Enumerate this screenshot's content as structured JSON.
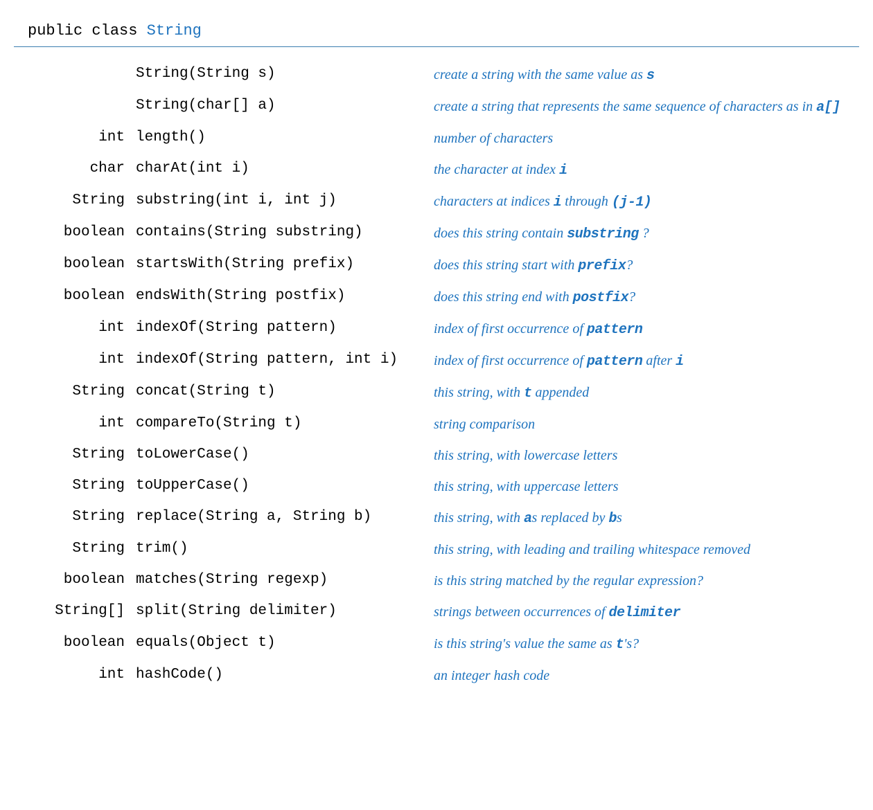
{
  "header": {
    "keyword": "public class",
    "classname": "String"
  },
  "methods": [
    {
      "return_type": "",
      "signature": "String(String s)",
      "description_parts": [
        {
          "t": "text",
          "v": "create a string with the same value as "
        },
        {
          "t": "code",
          "v": "s"
        }
      ]
    },
    {
      "return_type": "",
      "signature": "String(char[] a)",
      "description_parts": [
        {
          "t": "text",
          "v": "create a string that represents the same sequence of characters as in "
        },
        {
          "t": "code",
          "v": "a[]"
        }
      ]
    },
    {
      "return_type": "int",
      "signature": "length()",
      "description_parts": [
        {
          "t": "text",
          "v": "number of characters"
        }
      ]
    },
    {
      "return_type": "char",
      "signature": "charAt(int i)",
      "description_parts": [
        {
          "t": "text",
          "v": "the character at index "
        },
        {
          "t": "code",
          "v": "i"
        }
      ]
    },
    {
      "return_type": "String",
      "signature": "substring(int i, int j)",
      "description_parts": [
        {
          "t": "text",
          "v": "characters at indices "
        },
        {
          "t": "code",
          "v": "i"
        },
        {
          "t": "text",
          "v": " through "
        },
        {
          "t": "code",
          "v": "(j-1)"
        }
      ]
    },
    {
      "return_type": "boolean",
      "signature": "contains(String substring)",
      "description_parts": [
        {
          "t": "text",
          "v": "does this string contain "
        },
        {
          "t": "code",
          "v": "substring"
        },
        {
          "t": "text",
          "v": " ?"
        }
      ]
    },
    {
      "return_type": "boolean",
      "signature": "startsWith(String prefix)",
      "description_parts": [
        {
          "t": "text",
          "v": "does this string start with "
        },
        {
          "t": "code",
          "v": "prefix"
        },
        {
          "t": "text",
          "v": "?"
        }
      ]
    },
    {
      "return_type": "boolean",
      "signature": "endsWith(String postfix)",
      "description_parts": [
        {
          "t": "text",
          "v": "does this string end with "
        },
        {
          "t": "code",
          "v": "postfix"
        },
        {
          "t": "text",
          "v": "?"
        }
      ]
    },
    {
      "return_type": "int",
      "signature": "indexOf(String pattern)",
      "description_parts": [
        {
          "t": "text",
          "v": "index of first occurrence of "
        },
        {
          "t": "code",
          "v": "pattern"
        }
      ]
    },
    {
      "return_type": "int",
      "signature": "indexOf(String pattern, int i)",
      "description_parts": [
        {
          "t": "text",
          "v": "index of first occurrence of "
        },
        {
          "t": "code",
          "v": "pattern"
        },
        {
          "t": "text",
          "v": " after "
        },
        {
          "t": "code",
          "v": "i"
        }
      ]
    },
    {
      "return_type": "String",
      "signature": "concat(String t)",
      "description_parts": [
        {
          "t": "text",
          "v": "this string, with "
        },
        {
          "t": "code",
          "v": "t"
        },
        {
          "t": "text",
          "v": " appended"
        }
      ]
    },
    {
      "return_type": "int",
      "signature": "compareTo(String t)",
      "description_parts": [
        {
          "t": "text",
          "v": "string comparison"
        }
      ]
    },
    {
      "return_type": "String",
      "signature": "toLowerCase()",
      "description_parts": [
        {
          "t": "text",
          "v": "this string, with lowercase letters"
        }
      ]
    },
    {
      "return_type": "String",
      "signature": "toUpperCase()",
      "description_parts": [
        {
          "t": "text",
          "v": "this string, with uppercase letters"
        }
      ]
    },
    {
      "return_type": "String",
      "signature": "replace(String a, String b)",
      "description_parts": [
        {
          "t": "text",
          "v": "this string, with "
        },
        {
          "t": "code",
          "v": "a"
        },
        {
          "t": "text",
          "v": "s replaced by "
        },
        {
          "t": "code",
          "v": "b"
        },
        {
          "t": "text",
          "v": "s"
        }
      ]
    },
    {
      "return_type": "String",
      "signature": "trim()",
      "description_parts": [
        {
          "t": "text",
          "v": "this string, with leading and trailing whitespace removed"
        }
      ]
    },
    {
      "return_type": "boolean",
      "signature": "matches(String regexp)",
      "description_parts": [
        {
          "t": "text",
          "v": "is this string matched by the regular expression?"
        }
      ]
    },
    {
      "return_type": "String[]",
      "signature": "split(String delimiter)",
      "description_parts": [
        {
          "t": "text",
          "v": "strings between occurrences of "
        },
        {
          "t": "code",
          "v": "delimiter"
        }
      ]
    },
    {
      "return_type": "boolean",
      "signature": "equals(Object t)",
      "description_parts": [
        {
          "t": "text",
          "v": "is this string's value the same as "
        },
        {
          "t": "code",
          "v": "t"
        },
        {
          "t": "text",
          "v": "'s?"
        }
      ]
    },
    {
      "return_type": "int",
      "signature": "hashCode()",
      "description_parts": [
        {
          "t": "text",
          "v": "an integer hash code"
        }
      ]
    }
  ]
}
